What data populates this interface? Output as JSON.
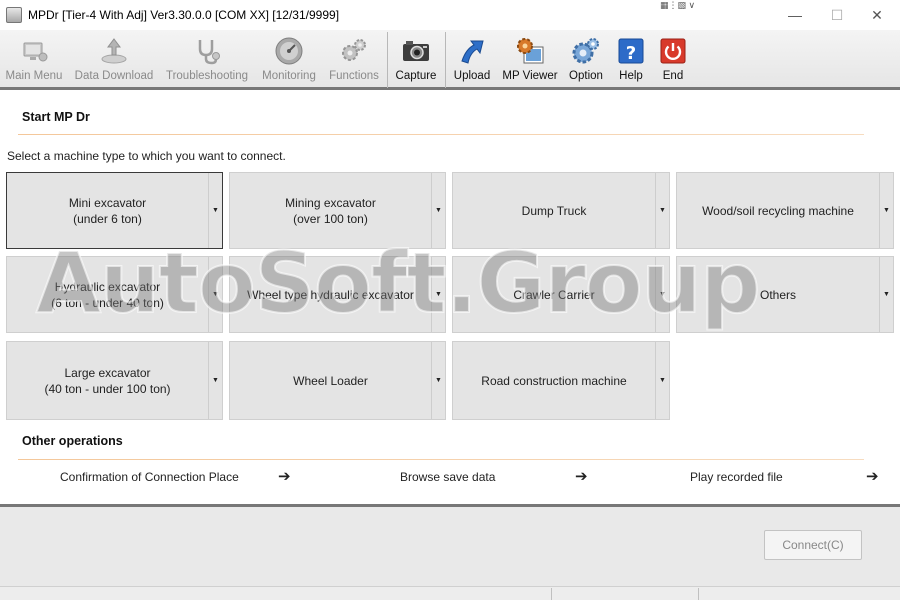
{
  "window": {
    "title": "MPDr [Tier-4 With Adj] Ver3.30.0.0 [COM XX] [12/31/9999]",
    "ime_indicator": "▦⋮▧ ∨",
    "controls": {
      "minimize": "—",
      "maximize": "☐",
      "close": "✕"
    }
  },
  "toolbar": {
    "items": [
      {
        "label": "Main Menu",
        "icon": "main-menu-icon",
        "enabled": false
      },
      {
        "label": "Data Download",
        "icon": "data-download-icon",
        "enabled": false
      },
      {
        "label": "Troubleshooting",
        "icon": "stethoscope-icon",
        "enabled": false
      },
      {
        "label": "Monitoring",
        "icon": "gauge-icon",
        "enabled": false
      },
      {
        "label": "Functions",
        "icon": "functions-gears-icon",
        "enabled": false
      },
      {
        "label": "Capture",
        "icon": "camera-icon",
        "enabled": true
      },
      {
        "label": "Upload",
        "icon": "upload-arrow-icon",
        "enabled": true
      },
      {
        "label": "MP Viewer",
        "icon": "mp-viewer-icon",
        "enabled": true
      },
      {
        "label": "Option",
        "icon": "option-gear-icon",
        "enabled": true
      },
      {
        "label": "Help",
        "icon": "help-icon",
        "enabled": true
      },
      {
        "label": "End",
        "icon": "power-icon",
        "enabled": true
      }
    ]
  },
  "start": {
    "title": "Start MP Dr",
    "instruction": "Select a machine type to which you want to connect."
  },
  "machines": [
    {
      "label": "Mini excavator\n(under 6 ton)",
      "selected": true
    },
    {
      "label": "Mining excavator\n(over 100 ton)",
      "selected": false
    },
    {
      "label": "Dump Truck",
      "selected": false
    },
    {
      "label": "Wood/soil recycling machine",
      "selected": false
    },
    {
      "label": "Hydraulic excavator\n(6 ton - under 40 ton)",
      "selected": false
    },
    {
      "label": "Wheel type hydraulic excavator",
      "selected": false
    },
    {
      "label": "Crawler Carrier",
      "selected": false
    },
    {
      "label": "Others",
      "selected": false
    },
    {
      "label": "Large excavator\n(40 ton - under 100 ton)",
      "selected": false
    },
    {
      "label": "Wheel Loader",
      "selected": false
    },
    {
      "label": "Road construction machine",
      "selected": false
    }
  ],
  "dropdown_glyph": "▼",
  "other_ops": {
    "title": "Other operations",
    "arrow": "➔",
    "items": [
      {
        "label": "Confirmation of Connection Place"
      },
      {
        "label": "Browse save data"
      },
      {
        "label": "Play recorded file"
      }
    ]
  },
  "watermark": "AutoSoft.Group",
  "connect_button": "Connect(C)",
  "colors": {
    "accent_line": "#f4c79a",
    "toolbar_border": "#777777",
    "button_face": "#e4e4e4"
  }
}
